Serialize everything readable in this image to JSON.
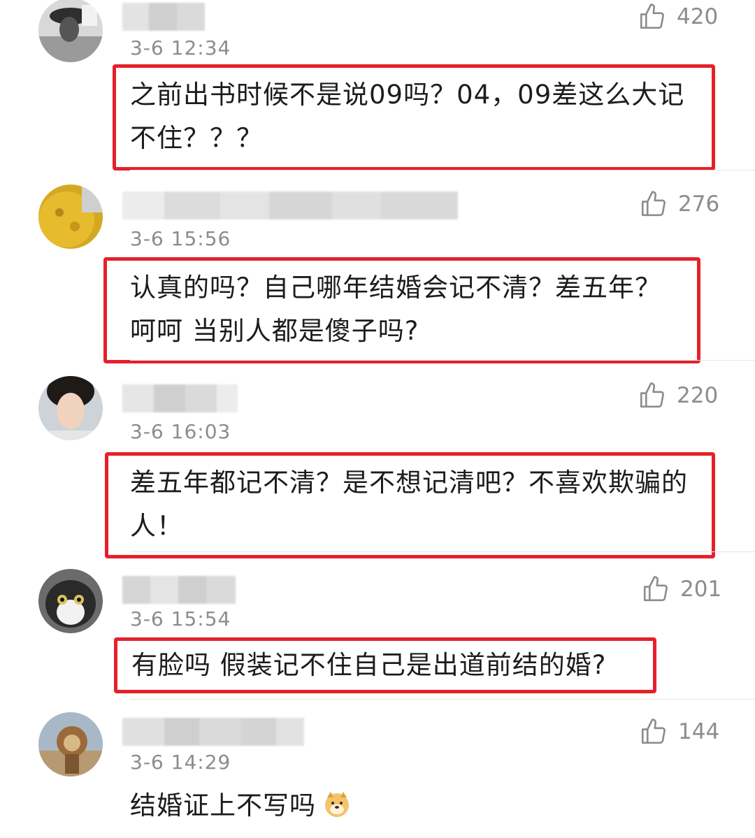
{
  "comments": [
    {
      "time": "3-6 12:34",
      "likes": "420",
      "text": "之前出书时候不是说09吗？04，09差这么大记不住？？？",
      "highlighted": true
    },
    {
      "time": "3-6 15:56",
      "likes": "276",
      "text": "认真的吗？自己哪年结婚会记不清？差五年？呵呵 当别人都是傻子吗?",
      "highlighted": true
    },
    {
      "time": "3-6 16:03",
      "likes": "220",
      "text": "差五年都记不清？是不想记清吧？不喜欢欺骗的人！",
      "highlighted": true
    },
    {
      "time": "3-6 15:54",
      "likes": "201",
      "text": "有脸吗 假装记不住自己是出道前结的婚?",
      "highlighted": true
    },
    {
      "time": "3-6 14:29",
      "likes": "144",
      "text": "结婚证上不写吗",
      "highlighted": false,
      "emoji": "doge-emoji"
    }
  ],
  "icons": {
    "like": "thumbs-up-icon"
  },
  "colors": {
    "highlight_border": "#e6202a",
    "meta_text": "#8c8c8c",
    "divider": "#e6e6e6"
  }
}
